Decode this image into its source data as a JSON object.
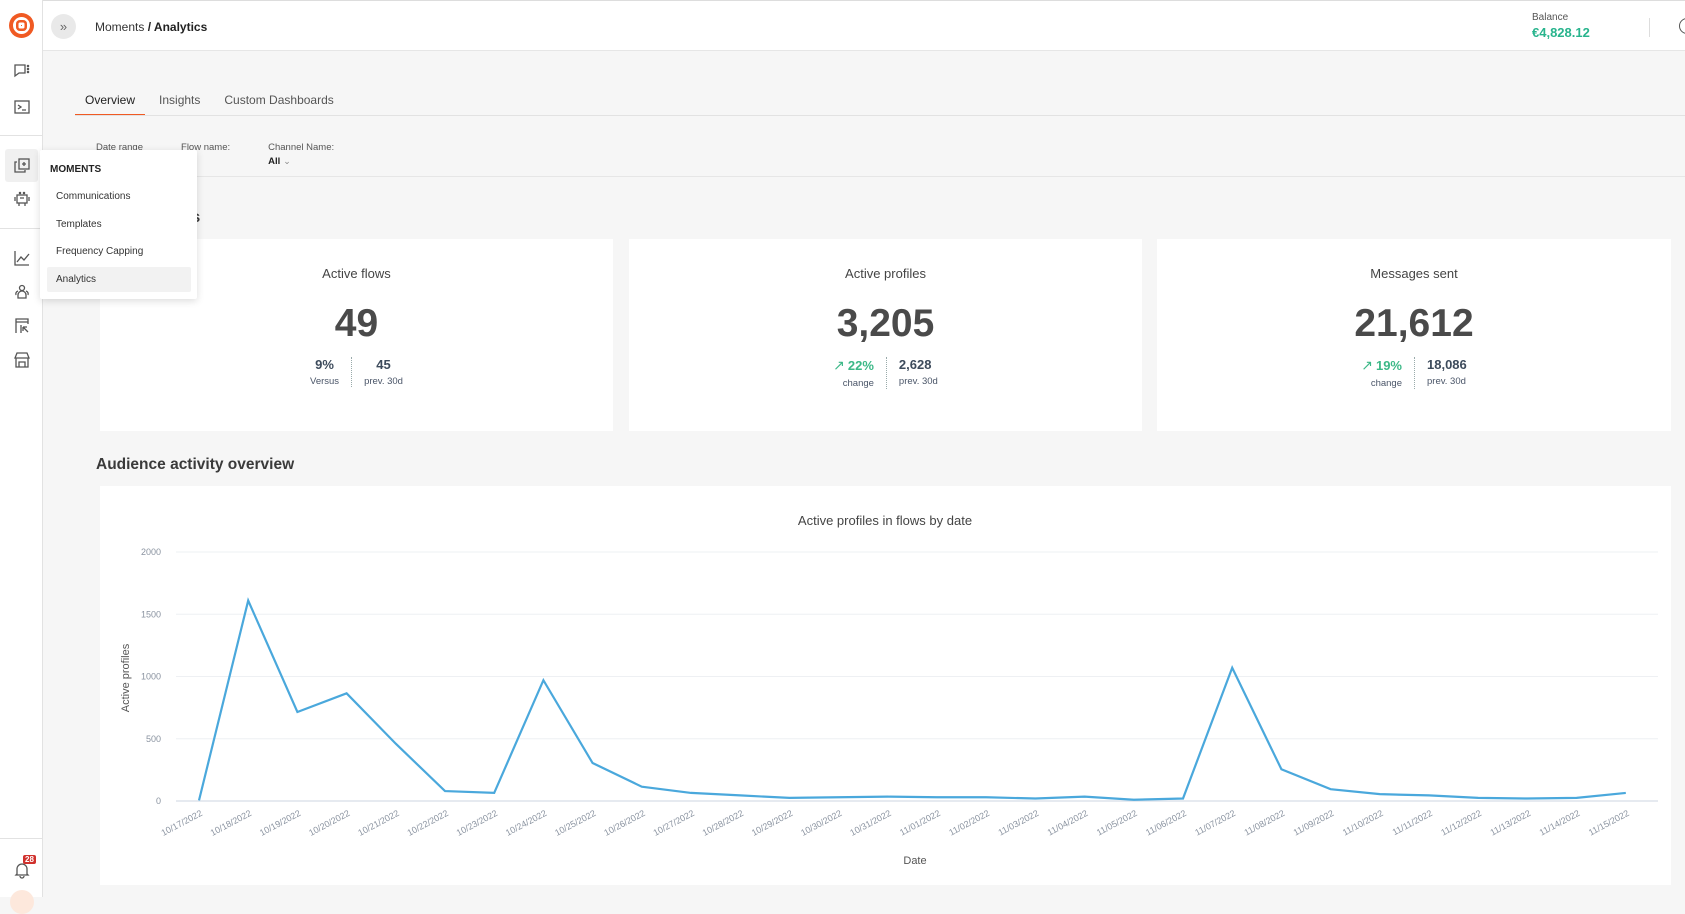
{
  "sidebar": {
    "logo": "brand-logo",
    "icons": [
      "conversations-icon",
      "terminal-icon",
      "moments-icon",
      "bot-icon",
      "analytics-icon",
      "people-icon",
      "exports-icon",
      "store-icon"
    ],
    "notifications_count": "28"
  },
  "header": {
    "breadcrumb_parent": "Moments",
    "breadcrumb_separator": " / ",
    "breadcrumb_current": "Analytics",
    "balance_label": "Balance",
    "balance_value": "€4,828.12",
    "balance_color": "#28b48d"
  },
  "tabs": [
    {
      "label": "Overview",
      "active": true
    },
    {
      "label": "Insights",
      "active": false
    },
    {
      "label": "Custom Dashboards",
      "active": false
    }
  ],
  "filters": [
    {
      "label": "Date range",
      "value": ""
    },
    {
      "label": "Flow name:",
      "value": ""
    },
    {
      "label": "Channel Name:",
      "value": "All"
    }
  ],
  "kpi_section_title_visible": "nts",
  "kpis": [
    {
      "title": "Active flows",
      "value": "49",
      "left_value": "9%",
      "left_caption": "Versus",
      "trend": "none",
      "right_value": "45",
      "right_caption": "prev. 30d"
    },
    {
      "title": "Active profiles",
      "value": "3,205",
      "left_value": "22%",
      "left_caption": "change",
      "trend": "up",
      "right_value": "2,628",
      "right_caption": "prev. 30d"
    },
    {
      "title": "Messages sent",
      "value": "21,612",
      "left_value": "19%",
      "left_caption": "change",
      "trend": "up",
      "right_value": "18,086",
      "right_caption": "prev. 30d"
    }
  ],
  "audience_section_title": "Audience activity overview",
  "popup_menu": {
    "title": "MOMENTS",
    "items": [
      {
        "label": "Communications",
        "selected": false
      },
      {
        "label": "Templates",
        "selected": false
      },
      {
        "label": "Frequency Capping",
        "selected": false
      },
      {
        "label": "Analytics",
        "selected": true
      }
    ]
  },
  "chart_data": {
    "type": "line",
    "title": "Active profiles in flows by date",
    "xlabel": "Date",
    "ylabel": "Active profiles",
    "ylim": [
      0,
      2000
    ],
    "yticks": [
      0,
      500,
      1000,
      1500,
      2000
    ],
    "grid": true,
    "line_color": "#4aa8dc",
    "x": [
      "10/17/2022",
      "10/18/2022",
      "10/19/2022",
      "10/20/2022",
      "10/21/2022",
      "10/22/2022",
      "10/23/2022",
      "10/24/2022",
      "10/25/2022",
      "10/26/2022",
      "10/27/2022",
      "10/28/2022",
      "10/29/2022",
      "10/30/2022",
      "10/31/2022",
      "11/01/2022",
      "11/02/2022",
      "11/03/2022",
      "11/04/2022",
      "11/05/2022",
      "11/06/2022",
      "11/07/2022",
      "11/08/2022",
      "11/09/2022",
      "11/10/2022",
      "11/11/2022",
      "11/12/2022",
      "11/13/2022",
      "11/14/2022",
      "11/15/2022"
    ],
    "series": [
      {
        "name": "Active profiles",
        "values": [
          5,
          1610,
          715,
          865,
          460,
          80,
          65,
          970,
          305,
          115,
          65,
          45,
          25,
          30,
          35,
          30,
          30,
          20,
          35,
          10,
          20,
          1070,
          255,
          95,
          55,
          45,
          25,
          20,
          25,
          65
        ]
      }
    ]
  }
}
